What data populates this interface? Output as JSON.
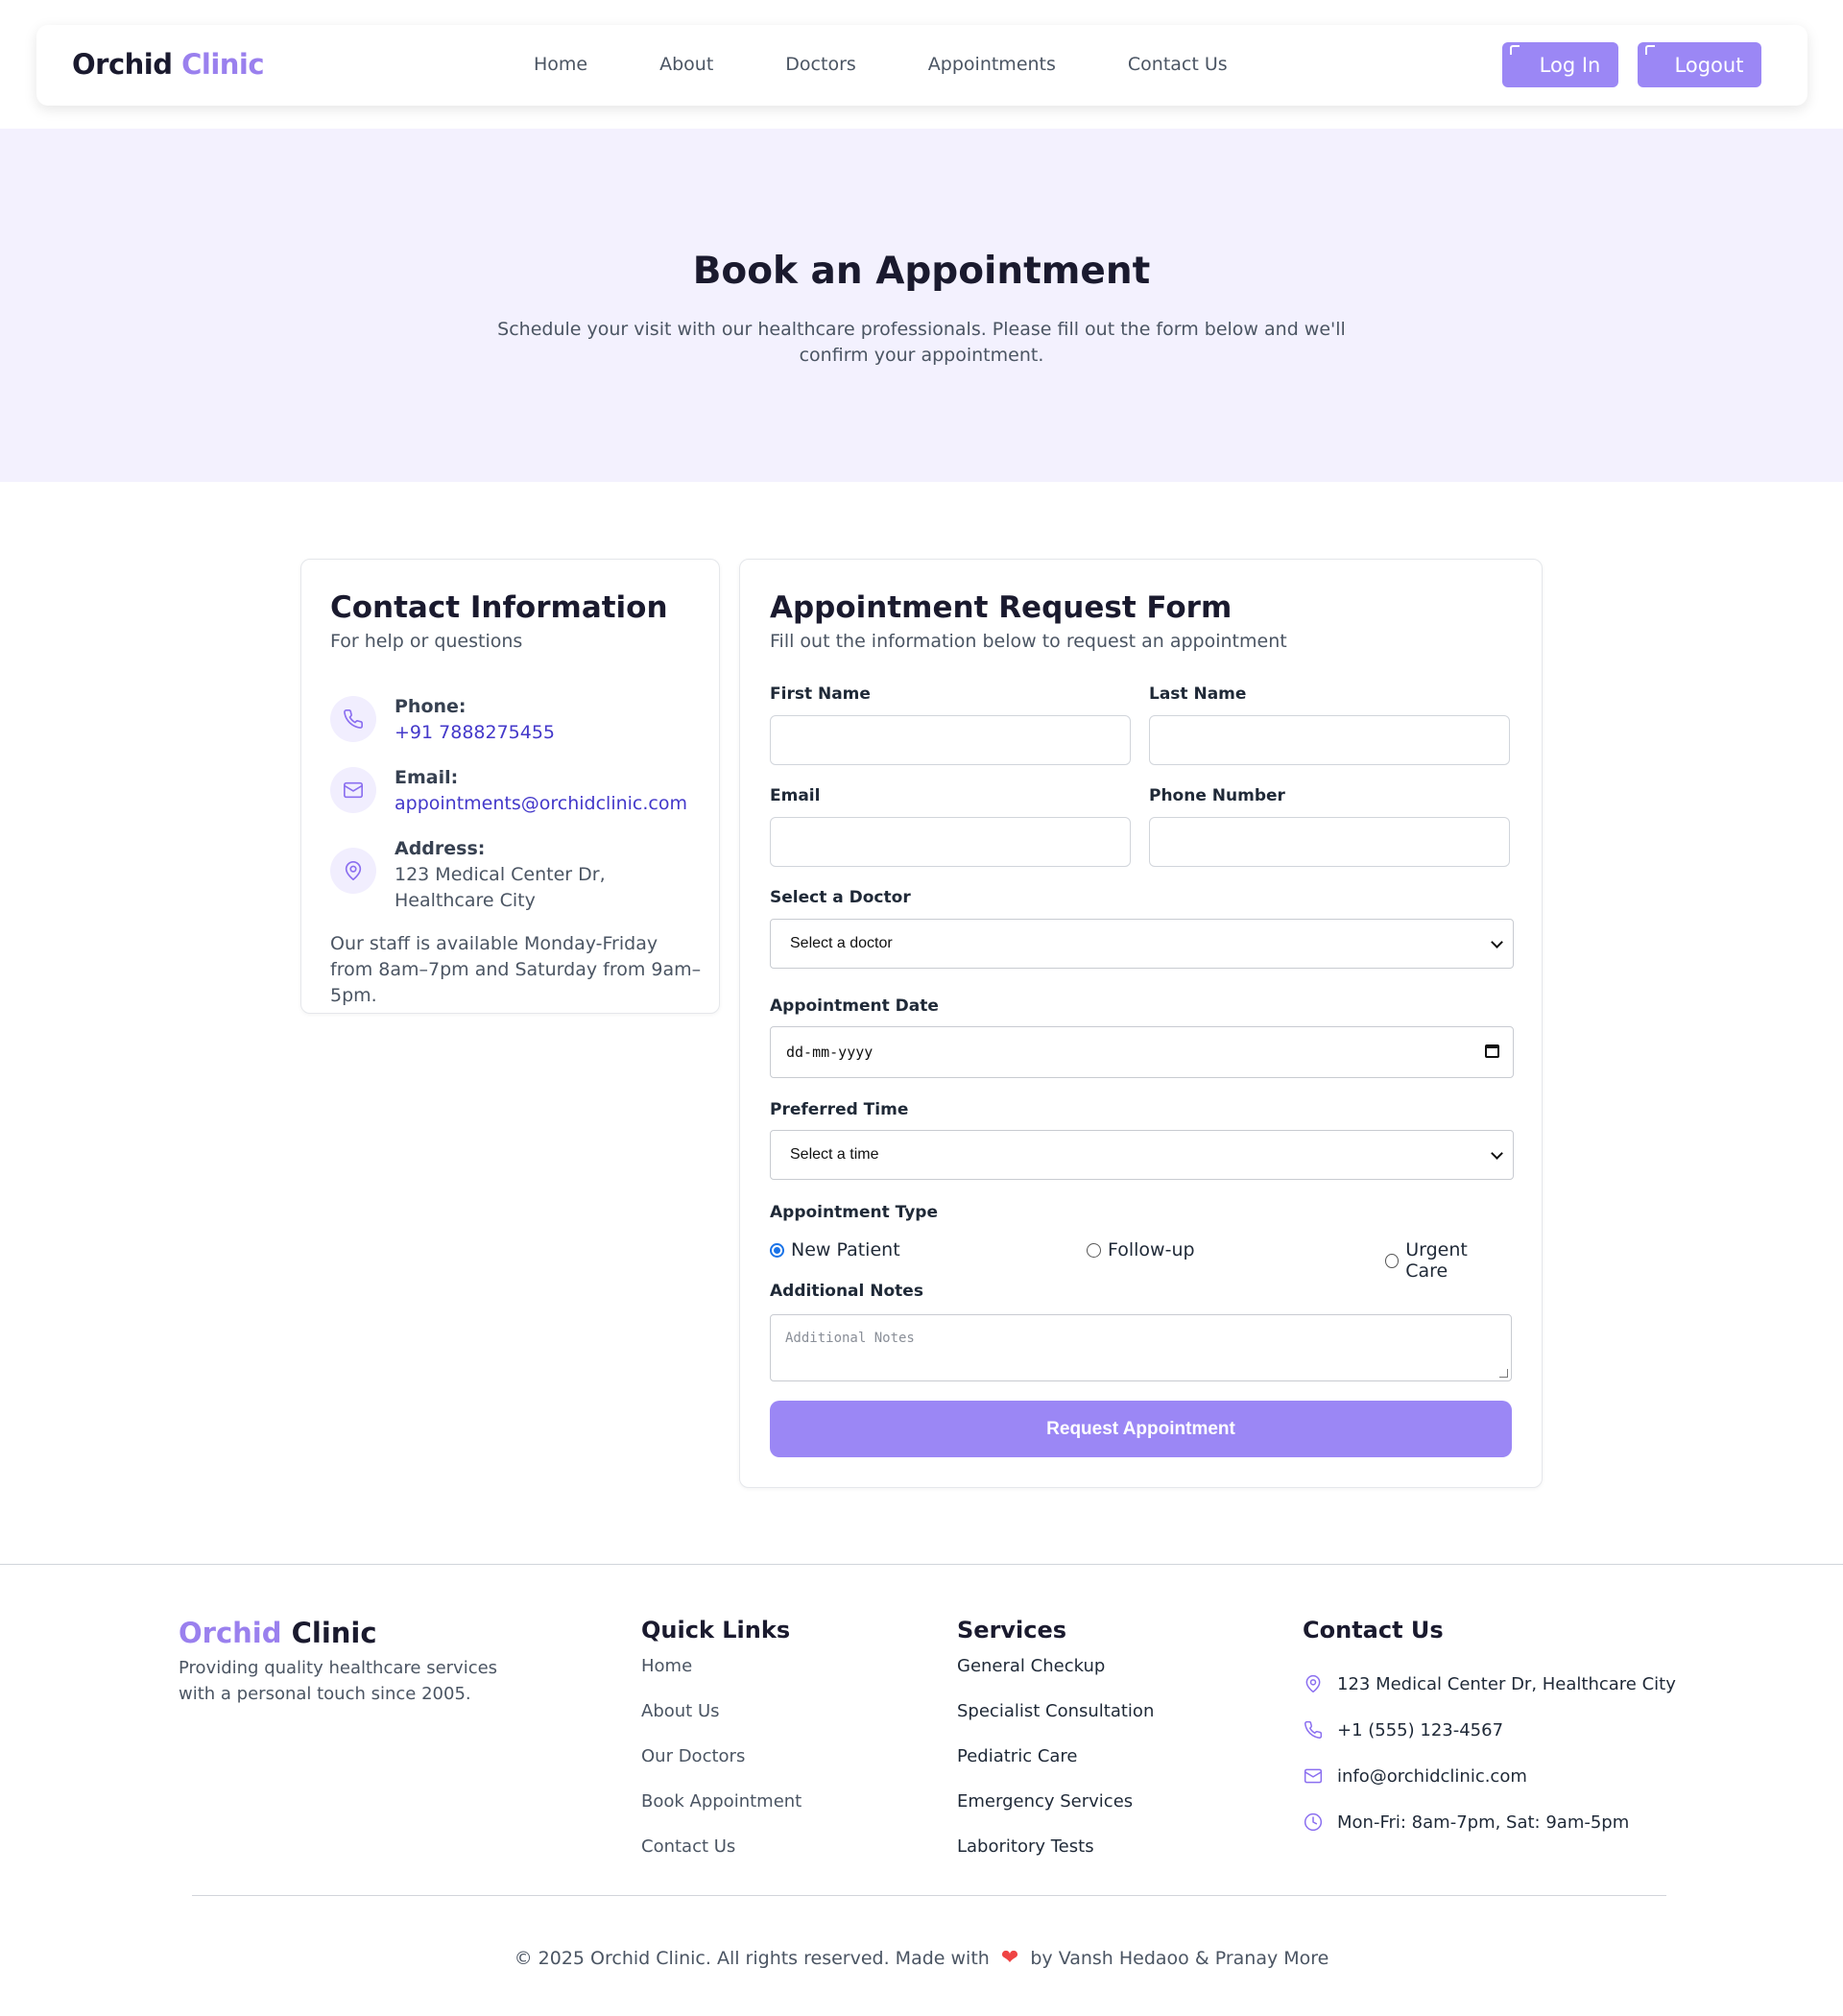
{
  "header": {
    "brand_main": "Orchid",
    "brand_accent": "Clinic",
    "nav": [
      "Home",
      "About",
      "Doctors",
      "Appointments",
      "Contact Us"
    ],
    "login_label": "Log In",
    "logout_label": "Logout"
  },
  "hero": {
    "title": "Book an Appointment",
    "subtitle": "Schedule your visit with our healthcare professionals. Please fill out the form below and we'll confirm your appointment."
  },
  "contact_card": {
    "title": "Contact Information",
    "subtitle": "For help or questions",
    "phone_label": "Phone:",
    "phone_value": "+91 7888275455",
    "email_label": "Email:",
    "email_value": "appointments@orchidclinic.com",
    "address_label": "Address:",
    "address_line1": "123 Medical Center Dr,",
    "address_line2": "Healthcare City",
    "staff_note": "Our staff is available Monday-Friday from 8am–7pm and Saturday from 9am–5pm."
  },
  "form": {
    "title": "Appointment Request Form",
    "subtitle": "Fill out the information below to request an appointment",
    "first_name_label": "First Name",
    "last_name_label": "Last Name",
    "email_label": "Email",
    "phone_label": "Phone Number",
    "doctor_label": "Select a Doctor",
    "doctor_selected": "Select a doctor",
    "date_label": "Appointment Date",
    "date_placeholder": "dd-mm-yyyy",
    "time_label": "Preferred Time",
    "time_selected": "Select a time",
    "type_label": "Appointment Type",
    "type_options": [
      "New Patient",
      "Follow-up",
      "Urgent Care"
    ],
    "type_selected": "New Patient",
    "notes_label": "Additional Notes",
    "notes_placeholder": "Additional Notes",
    "submit_label": "Request Appointment"
  },
  "footer": {
    "brand_accent": "Orchid",
    "brand_main": "Clinic",
    "tagline": "Providing quality healthcare services with a personal touch since 2005.",
    "quick_links_title": "Quick Links",
    "quick_links": [
      "Home",
      "About Us",
      "Our Doctors",
      "Book Appointment",
      "Contact Us"
    ],
    "services_title": "Services",
    "services": [
      "General Checkup",
      "Specialist Consultation",
      "Pediatric Care",
      "Emergency Services",
      "Laboritory Tests"
    ],
    "contact_title": "Contact Us",
    "contact_address": "123 Medical Center Dr, Healthcare City",
    "contact_phone": "+1 (555) 123-4567",
    "contact_email": "info@orchidclinic.com",
    "contact_hours": "Mon-Fri: 8am-7pm, Sat: 9am-5pm",
    "copyright_left": "© 2025 Orchid Clinic. All rights reserved. Made with",
    "copyright_right": "by Vansh Hedaoo & Pranay More"
  },
  "colors": {
    "accent": "#9b87f5",
    "hero_bg": "#f3f1fe",
    "link": "#4338ca"
  },
  "icons": [
    "phone-icon",
    "mail-icon",
    "map-pin-icon",
    "clock-icon",
    "heart-icon",
    "calendar-icon"
  ]
}
